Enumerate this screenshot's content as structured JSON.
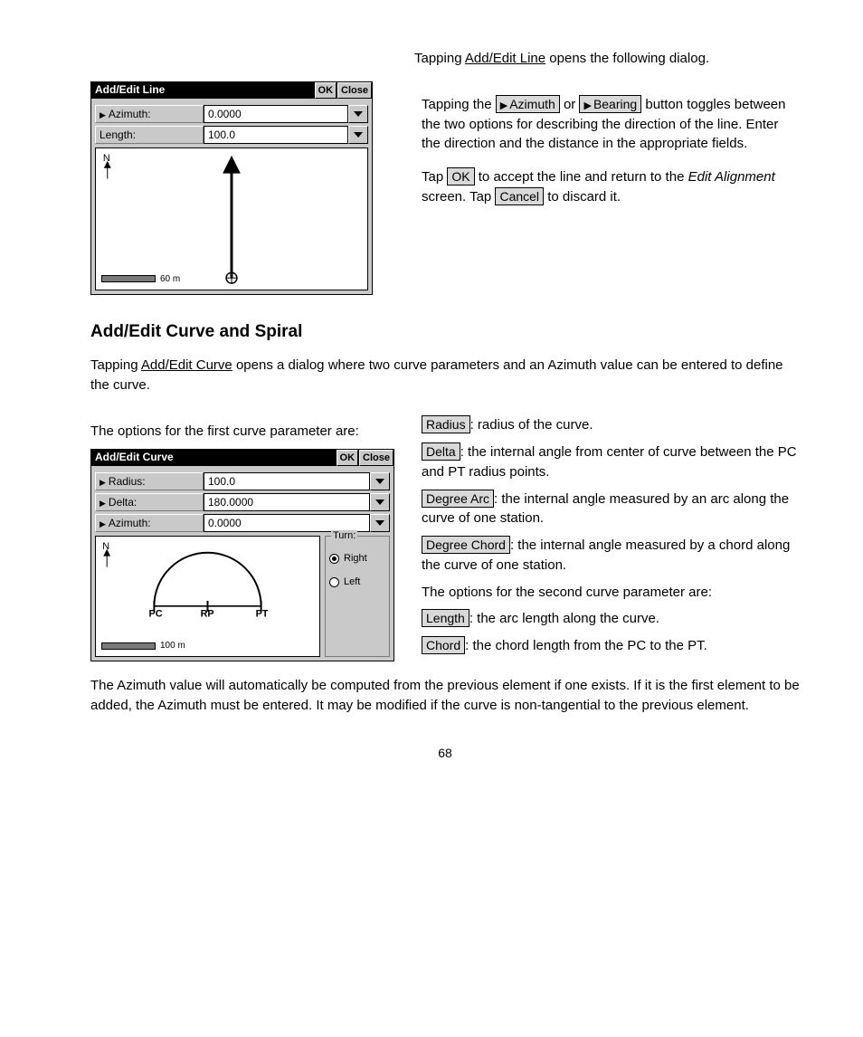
{
  "page_number": "68",
  "line_section": {
    "lead_in": "Tapping ",
    "link": "Add/Edit Line",
    "after_link": " opens the following dialog.",
    "para1_a": "Tapping the ",
    "btn_az": "Azimuth",
    "para1_b": " or ",
    "btn_br": "Bearing",
    "para1_c": " button toggles between the two options for describing the direction of the line. Enter the direction and the distance in the appropriate fields.",
    "para2_a": "Tap ",
    "btn_ok": "OK",
    "para2_b": " to accept the line and return to the ",
    "em": "Edit Alignment",
    "para2_c": " screen. Tap ",
    "btn_cancel": "Cancel",
    "para2_d": " to discard it."
  },
  "dlg_line": {
    "title": "Add/Edit Line",
    "ok": "OK",
    "close": "Close",
    "azimuth_label": "Azimuth:",
    "azimuth_value": "0.0000",
    "length_label": "Length:",
    "length_value": "100.0",
    "scale": "60 m"
  },
  "curve_section": {
    "heading": "Add/Edit Curve and Spiral",
    "lead_in": "Tapping ",
    "link": "Add/Edit Curve",
    "after_link": " opens a dialog where two curve parameters and an Azimuth value can be entered to define the curve.",
    "options_intro": "The options for the first curve parameter are:",
    "opt_radius": "Radius",
    "opt_radius_desc": ": radius of the curve.",
    "opt_delta": "Delta",
    "opt_delta_desc": ": the internal angle from center of curve between the PC and PT radius points.",
    "opt_darc": "Degree Arc",
    "opt_darc_desc": ": the internal angle measured by an arc along the curve of one station.",
    "opt_dchord": "Degree Chord",
    "opt_dchord_desc": ": the internal angle measured by a chord along the curve of one station.",
    "options2_intro": "The options for the second curve parameter are:",
    "opt_length": "Length",
    "opt_length_desc": ": the arc length along the curve.",
    "opt_chord": "Chord",
    "opt_chord_desc": ": the chord length from the PC to the PT.",
    "bottom_para": "The Azimuth value will automatically be computed from the previous element if one exists. If it is the first element to be added, the Azimuth must be entered. It may be modified if the curve is non-tangential to the previous element."
  },
  "dlg_curve": {
    "title": "Add/Edit Curve",
    "ok": "OK",
    "close": "Close",
    "radius_label": "Radius:",
    "radius_value": "100.0",
    "delta_label": "Delta:",
    "delta_value": "180.0000",
    "azimuth_label": "Azimuth:",
    "azimuth_value": "0.0000",
    "turn_legend": "Turn:",
    "turn_right": "Right",
    "turn_left": "Left",
    "scale": "100 m",
    "pc": "PC",
    "rp": "RP",
    "pt": "PT"
  }
}
